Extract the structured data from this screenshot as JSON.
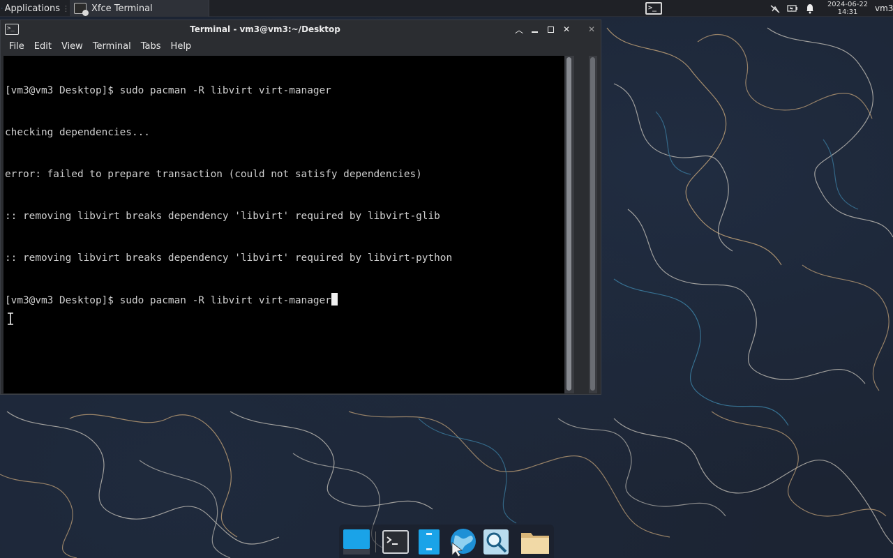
{
  "top_panel": {
    "applications_label": "Applications",
    "task_label": "Xfce Terminal",
    "clock_date": "2024-06-22",
    "clock_time": "14:31",
    "user": "vm3",
    "tray_icons": [
      "network-disconnected-icon",
      "battery-icon",
      "notification-bell-icon"
    ]
  },
  "window": {
    "title": "Terminal - vm3@vm3:~/Desktop",
    "menu": [
      "File",
      "Edit",
      "View",
      "Terminal",
      "Tabs",
      "Help"
    ]
  },
  "terminal": {
    "lines": [
      "[vm3@vm3 Desktop]$ sudo pacman -R libvirt virt-manager",
      "checking dependencies...",
      "error: failed to prepare transaction (could not satisfy dependencies)",
      ":: removing libvirt breaks dependency 'libvirt' required by libvirt-glib",
      ":: removing libvirt breaks dependency 'libvirt' required by libvirt-python"
    ],
    "prompt_line": "[vm3@vm3 Desktop]$ sudo pacman -R libvirt virt-manager"
  },
  "dock": {
    "items": [
      "desktop-icon",
      "terminal-icon",
      "text-editor-icon",
      "web-browser-icon",
      "search-icon",
      "file-manager-icon"
    ]
  },
  "colors": {
    "panel_bg": "#1f2126",
    "terminal_bg": "#000000",
    "terminal_fg": "#d0d0d0",
    "desktop_bg": "#1c2433"
  }
}
